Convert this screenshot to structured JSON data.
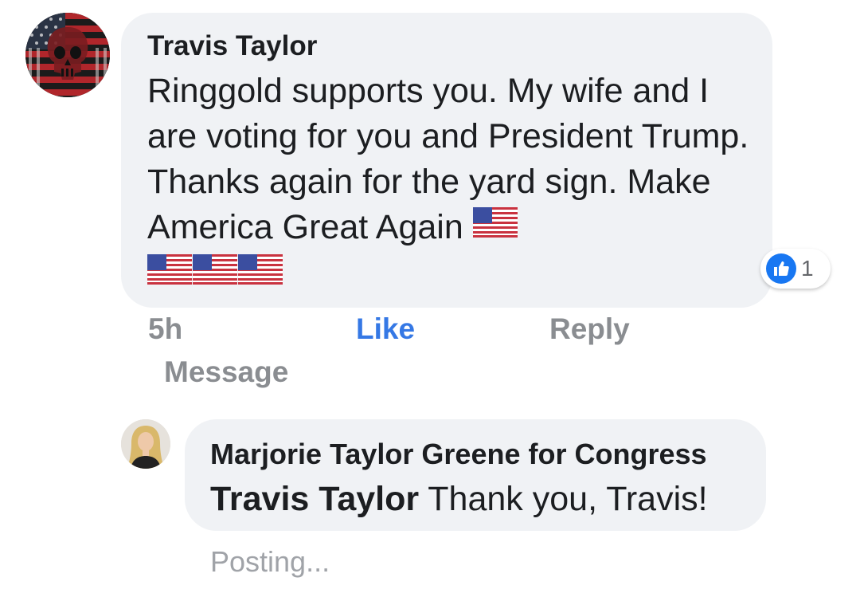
{
  "comment": {
    "author": "Travis Taylor",
    "text": "Ringgold supports you. My wife and I are voting for you and President Trump. Thanks again for the yard sign. Make America Great Again",
    "emojis": [
      "us-flag",
      "us-flag",
      "us-flag",
      "us-flag"
    ],
    "reaction": {
      "icon": "like-icon",
      "count": "1",
      "color": "#1877f2"
    },
    "time": "5h",
    "actions": {
      "like": "Like",
      "reply": "Reply",
      "message": "Message"
    }
  },
  "reply": {
    "author": "Marjorie Taylor Greene for Congress",
    "mention": "Travis Taylor",
    "text": " Thank you, Travis!",
    "status": "Posting..."
  },
  "colors": {
    "bubble": "#f0f2f5",
    "like_active": "#3578e5",
    "muted": "#8a8d91"
  }
}
